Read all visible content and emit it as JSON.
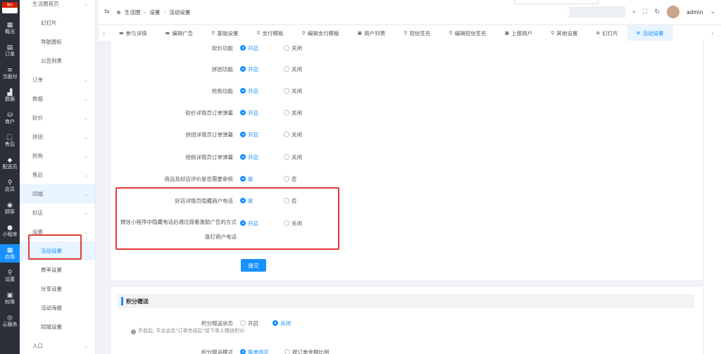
{
  "rail": {
    "logo_text": "微信",
    "items": [
      {
        "icon": "▦",
        "label": "概况"
      },
      {
        "icon": "▤",
        "label": "订单"
      },
      {
        "icon": "≡",
        "label": "当面付"
      },
      {
        "icon": "▟",
        "label": "数据"
      },
      {
        "icon": "⛁",
        "label": "商户"
      },
      {
        "icon": "🎧",
        "label": "售后"
      },
      {
        "icon": "◆",
        "label": "配送员"
      },
      {
        "icon": "⚲",
        "label": "店员"
      },
      {
        "icon": "◉",
        "label": "顾客"
      },
      {
        "icon": "●",
        "label": "小程序"
      },
      {
        "icon": "▦",
        "label": "应用",
        "active": true
      },
      {
        "icon": "⚲",
        "label": "设置"
      },
      {
        "icon": "▣",
        "label": "权限"
      },
      {
        "icon": "◎",
        "label": "云服务"
      }
    ]
  },
  "subnav": {
    "items": [
      {
        "label": "生活圈首页",
        "type": "group"
      },
      {
        "label": "幻灯片",
        "type": "child"
      },
      {
        "label": "导航图标",
        "type": "child"
      },
      {
        "label": "公告列表",
        "type": "child"
      },
      {
        "label": "订单",
        "type": "group"
      },
      {
        "label": "数据",
        "type": "group"
      },
      {
        "label": "砍价",
        "type": "group"
      },
      {
        "label": "拼团",
        "type": "group"
      },
      {
        "label": "抢购",
        "type": "group"
      },
      {
        "label": "售后",
        "type": "group"
      },
      {
        "label": "同城",
        "type": "group",
        "selected": true
      },
      {
        "label": "好店",
        "type": "group"
      },
      {
        "label": "设置",
        "type": "group"
      },
      {
        "label": "活动设置",
        "type": "child",
        "selected": true
      },
      {
        "label": "费率设置",
        "type": "child"
      },
      {
        "label": "分享设置",
        "type": "child"
      },
      {
        "label": "活动海报",
        "type": "child"
      },
      {
        "label": "同城设置",
        "type": "child"
      },
      {
        "label": "入口",
        "type": "group"
      }
    ]
  },
  "topbar": {
    "fold_icon": "⇆",
    "breadcrumb": [
      "生活圈",
      "设置",
      "活动设置"
    ],
    "user": "admin"
  },
  "tabs": [
    {
      "icon": "▬",
      "label": "参与详情"
    },
    {
      "icon": "▬",
      "label": "编辑广告"
    },
    {
      "icon": "⚲",
      "label": "基础设置"
    },
    {
      "icon": "⚲",
      "label": "支付模板"
    },
    {
      "icon": "⚲",
      "label": "编辑支付模板"
    },
    {
      "icon": "▣",
      "label": "商户列表"
    },
    {
      "icon": "⚲",
      "label": "短信签名"
    },
    {
      "icon": "⚲",
      "label": "编辑短信签名"
    },
    {
      "icon": "▣",
      "label": "上报商户"
    },
    {
      "icon": "⚲",
      "label": "其他设置"
    },
    {
      "icon": "⊗",
      "label": "幻灯片"
    },
    {
      "icon": "⊗",
      "label": "活动设置",
      "active": true
    }
  ],
  "form": {
    "rows": [
      {
        "label": "砍价功能",
        "opt1": "开启",
        "opt2": "关闭"
      },
      {
        "label": "拼团功能",
        "opt1": "开启",
        "opt2": "关闭"
      },
      {
        "label": "抢购功能",
        "opt1": "开启",
        "opt2": "关闭"
      },
      {
        "label": "砍价详情页订单弹幕",
        "opt1": "开启",
        "opt2": "关闭"
      },
      {
        "label": "拼团详情页订单弹幕",
        "opt1": "开启",
        "opt2": "关闭"
      },
      {
        "label": "抢购详情页订单弹幕",
        "opt1": "开启",
        "opt2": "关闭"
      },
      {
        "label": "商品及好店评价是否需要审核",
        "opt1": "是",
        "opt2": "否"
      },
      {
        "label": "好店详情页隐藏商户电话",
        "opt1": "是",
        "opt2": "否"
      }
    ],
    "wx_label_line1": "微信小程序中隐藏电话后通过观看激励广告的方式",
    "wx_label_line2": "拨打商户电话",
    "wx_opt1": "开启",
    "wx_opt2": "关闭",
    "submit": "提交"
  },
  "points": {
    "title": "积分赠送",
    "status_label": "积分赠送状态",
    "status_opt1": "开启",
    "status_opt2": "关闭",
    "hint": "开启后, 平台会在\"订单完成后\"给下单人赠送积分",
    "mode_label": "积分赠送模式",
    "mode_opt1": "每单固定",
    "mode_opt2": "按订单金额比例"
  },
  "colors": {
    "accent": "#1890ff",
    "highlight": "#e53935",
    "rail": "#2b2f3a"
  }
}
